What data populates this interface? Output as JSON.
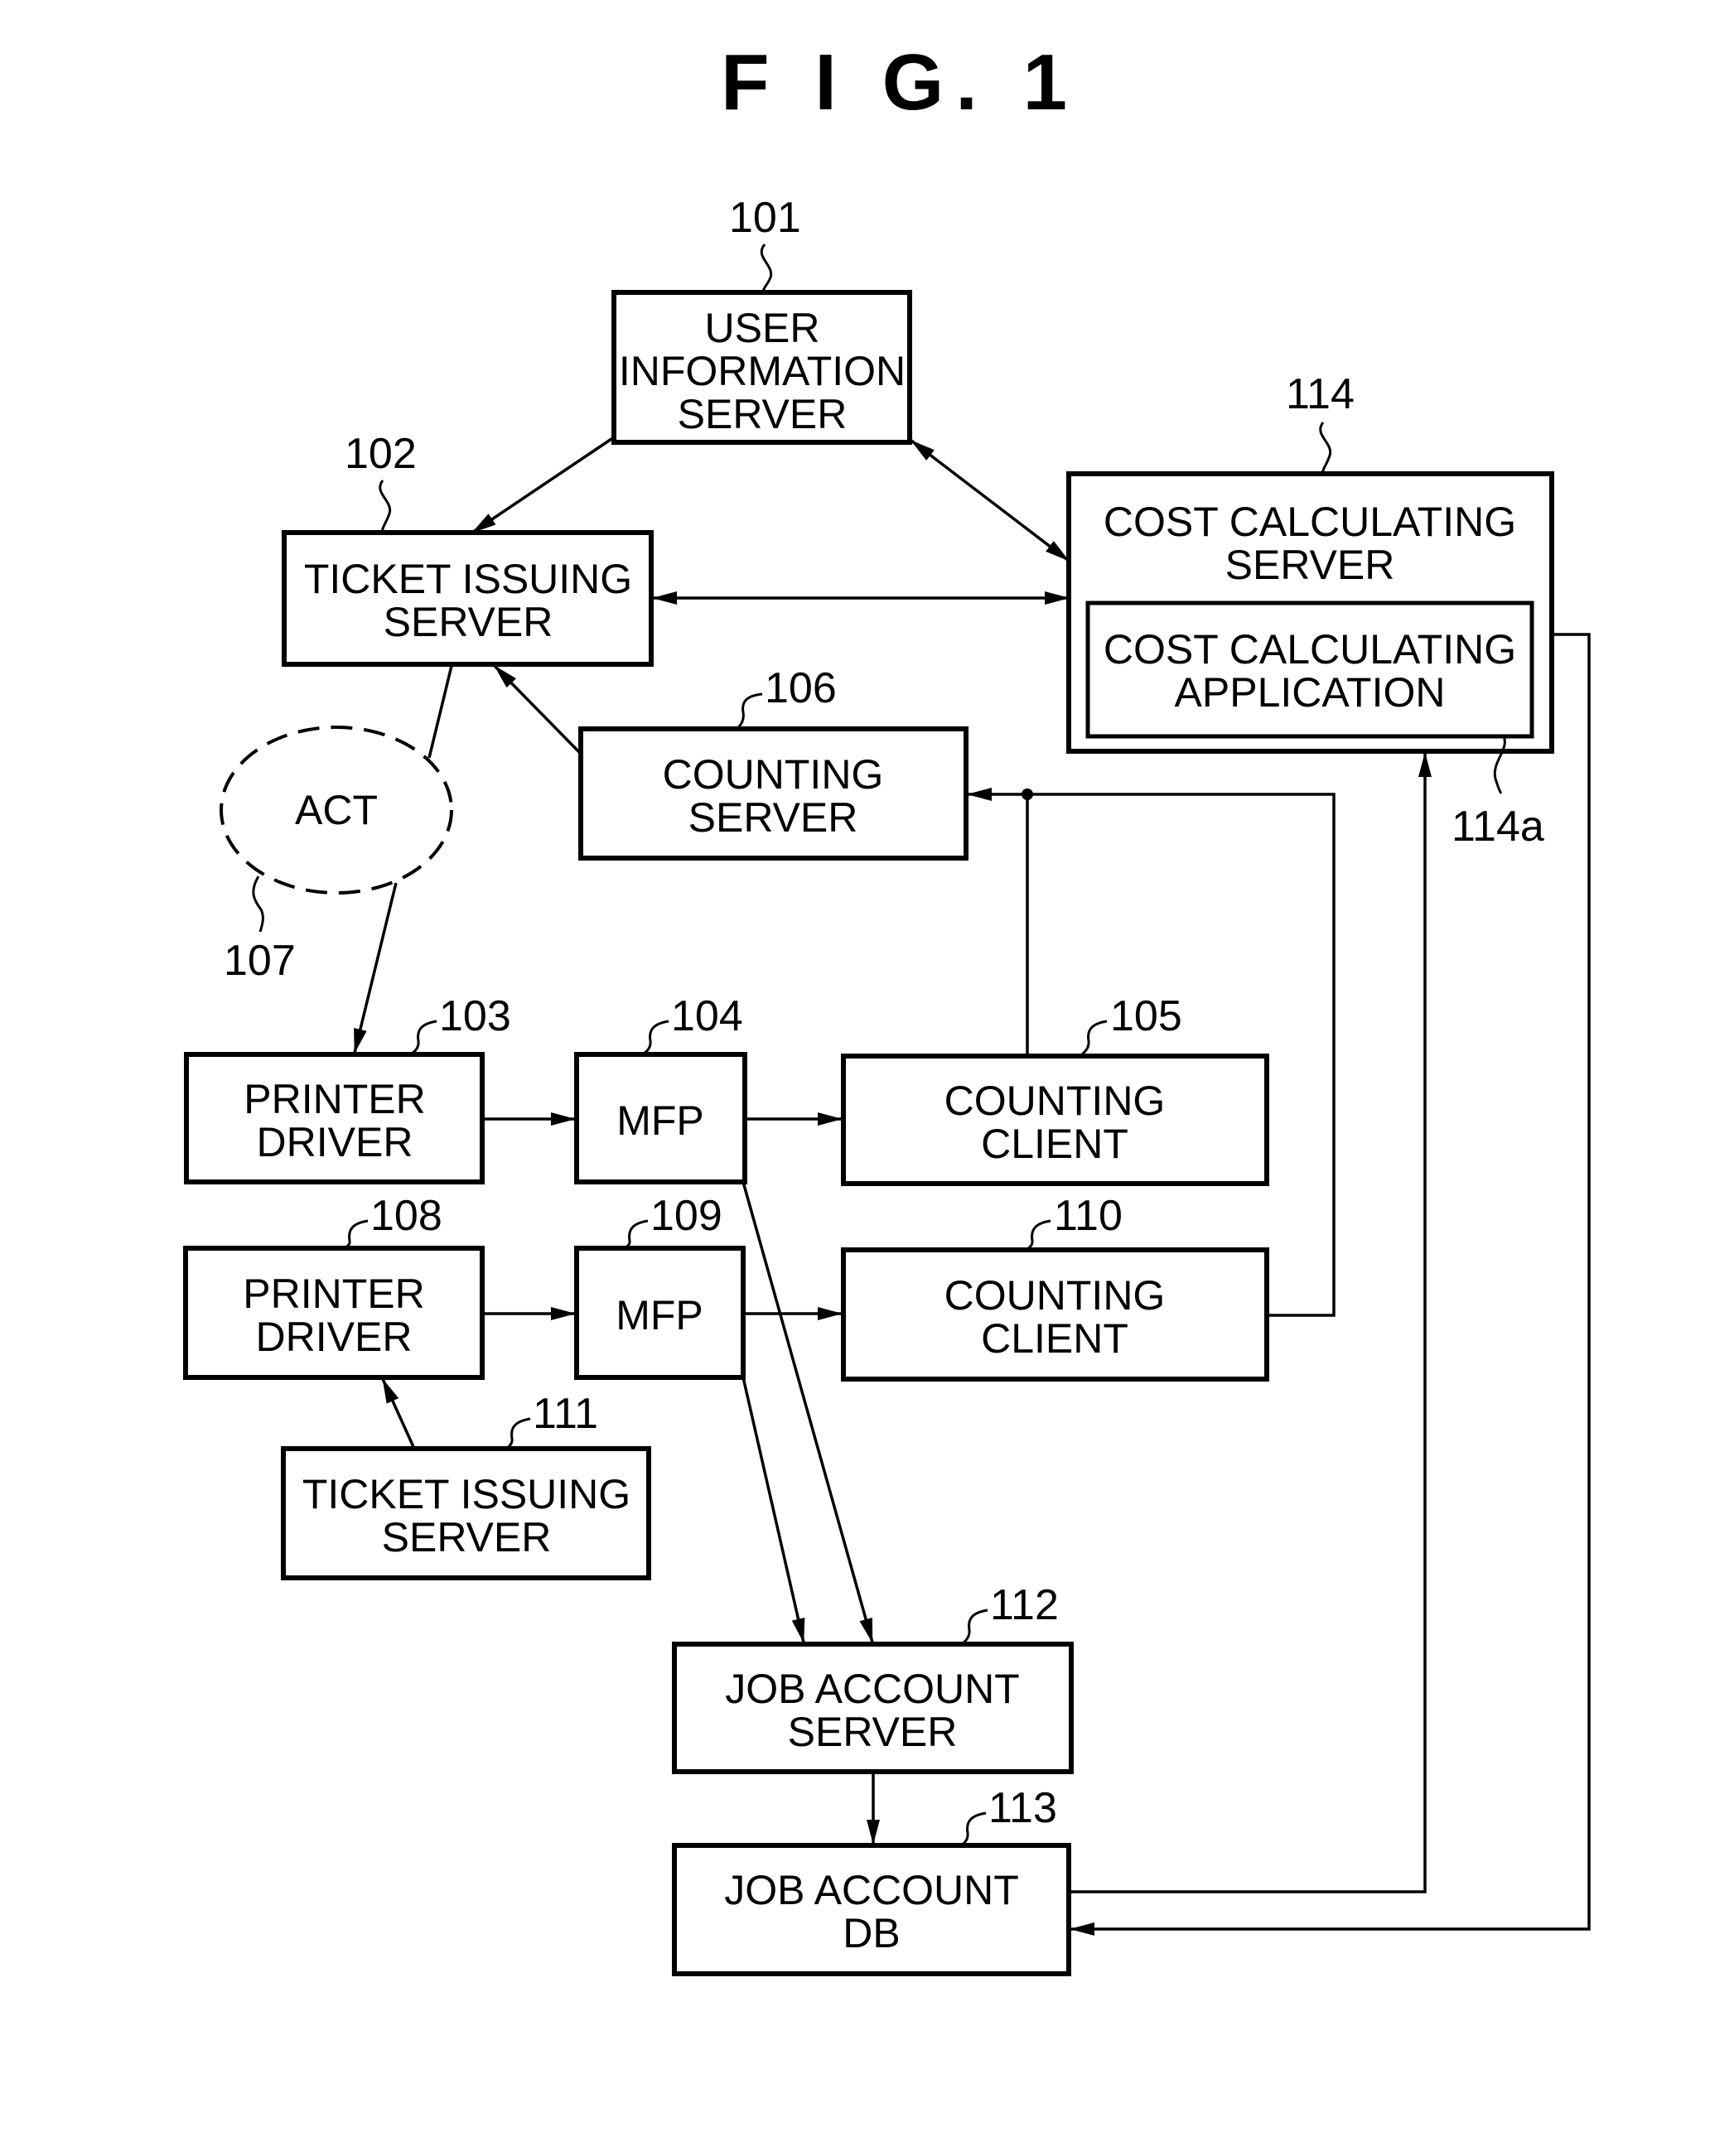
{
  "figure": {
    "title": "F I G. 1"
  },
  "nodes": {
    "user_info_server": {
      "ref": "101",
      "lines": [
        "USER",
        "INFORMATION",
        "SERVER"
      ]
    },
    "ticket_issuing_server_102": {
      "ref": "102",
      "lines": [
        "TICKET ISSUING",
        "SERVER"
      ]
    },
    "printer_driver_103": {
      "ref": "103",
      "lines": [
        "PRINTER",
        "DRIVER"
      ]
    },
    "mfp_104": {
      "ref": "104",
      "lines": [
        "MFP"
      ]
    },
    "counting_client_105": {
      "ref": "105",
      "lines": [
        "COUNTING",
        "CLIENT"
      ]
    },
    "counting_server_106": {
      "ref": "106",
      "lines": [
        "COUNTING",
        "SERVER"
      ]
    },
    "act_107": {
      "ref": "107",
      "lines": [
        "ACT"
      ]
    },
    "printer_driver_108": {
      "ref": "108",
      "lines": [
        "PRINTER",
        "DRIVER"
      ]
    },
    "mfp_109": {
      "ref": "109",
      "lines": [
        "MFP"
      ]
    },
    "counting_client_110": {
      "ref": "110",
      "lines": [
        "COUNTING",
        "CLIENT"
      ]
    },
    "ticket_issuing_server_111": {
      "ref": "111",
      "lines": [
        "TICKET ISSUING",
        "SERVER"
      ]
    },
    "job_account_server_112": {
      "ref": "112",
      "lines": [
        "JOB ACCOUNT",
        "SERVER"
      ]
    },
    "job_account_db_113": {
      "ref": "113",
      "lines": [
        "JOB ACCOUNT",
        "DB"
      ]
    },
    "cost_calculating_server_114": {
      "ref": "114",
      "lines": [
        "COST CALCULATING",
        "SERVER"
      ]
    },
    "cost_calculating_application_114a": {
      "ref": "114a",
      "lines": [
        "COST CALCULATING",
        "APPLICATION"
      ]
    }
  },
  "edges": [
    {
      "from": "101",
      "to": "102",
      "type": "arrow"
    },
    {
      "from": "101",
      "to": "114",
      "type": "bidirectional"
    },
    {
      "from": "102",
      "to": "114",
      "type": "bidirectional"
    },
    {
      "from": "106",
      "to": "102",
      "type": "arrow"
    },
    {
      "from": "102",
      "to": "103",
      "type": "arrow",
      "via": "107"
    },
    {
      "from": "103",
      "to": "104",
      "type": "arrow"
    },
    {
      "from": "104",
      "to": "105",
      "type": "arrow"
    },
    {
      "from": "105",
      "to": "106",
      "type": "arrow"
    },
    {
      "from": "110",
      "to": "106",
      "type": "arrow"
    },
    {
      "from": "108",
      "to": "109",
      "type": "arrow"
    },
    {
      "from": "109",
      "to": "110",
      "type": "arrow"
    },
    {
      "from": "111",
      "to": "108",
      "type": "arrow"
    },
    {
      "from": "104",
      "to": "112",
      "type": "arrow"
    },
    {
      "from": "109",
      "to": "112",
      "type": "arrow"
    },
    {
      "from": "112",
      "to": "113",
      "type": "arrow"
    },
    {
      "from": "113",
      "to": "114",
      "type": "arrow"
    },
    {
      "from": "114",
      "to": "113",
      "type": "arrow"
    }
  ]
}
